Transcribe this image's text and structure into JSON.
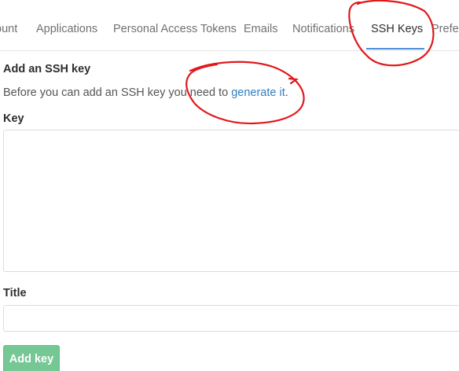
{
  "tabs": [
    {
      "label": "ount"
    },
    {
      "label": "Applications"
    },
    {
      "label": "Personal Access Tokens"
    },
    {
      "label": "Emails"
    },
    {
      "label": "Notifications"
    },
    {
      "label": "SSH Keys",
      "active": true
    },
    {
      "label": "Prefer"
    }
  ],
  "form": {
    "heading": "Add an SSH key",
    "intro_prefix": "Before you can add an SSH key you need to ",
    "intro_link": "generate it",
    "intro_suffix": ".",
    "key_label": "Key",
    "key_value": "",
    "title_label": "Title",
    "title_value": "",
    "submit_label": "Add key"
  },
  "colors": {
    "accent": "#4a8bd6",
    "link": "#2f7dc0",
    "button": "#75c794",
    "annotation": "#e0181b"
  }
}
